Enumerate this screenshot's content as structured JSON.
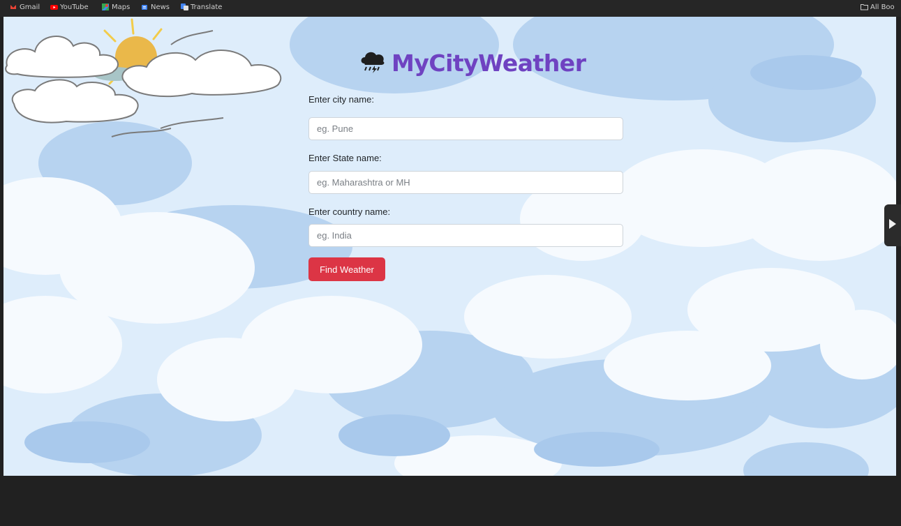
{
  "bookmarks": {
    "items": [
      {
        "label": "Gmail",
        "icon": "gmail-icon"
      },
      {
        "label": "YouTube",
        "icon": "youtube-icon"
      },
      {
        "label": "Maps",
        "icon": "maps-icon"
      },
      {
        "label": "News",
        "icon": "news-icon"
      },
      {
        "label": "Translate",
        "icon": "translate-icon"
      }
    ],
    "all_bookmarks_label": "All Boo",
    "all_bookmarks_icon": "folder-icon"
  },
  "app": {
    "title": "MyCityWeather",
    "logo_icon": "storm-cloud-icon",
    "title_color": "#6f42c1"
  },
  "form": {
    "city_label": "Enter city name:",
    "city_placeholder": "eg. Pune",
    "city_value": "",
    "state_label": "Enter State name:",
    "state_placeholder": "eg. Maharashtra or MH",
    "state_value": "",
    "country_label": "Enter country name:",
    "country_placeholder": "eg. India",
    "country_value": "",
    "submit_label": "Find Weather",
    "submit_color": "#dc3545"
  },
  "side_panel": {
    "toggle_icon": "play-triangle-icon"
  }
}
